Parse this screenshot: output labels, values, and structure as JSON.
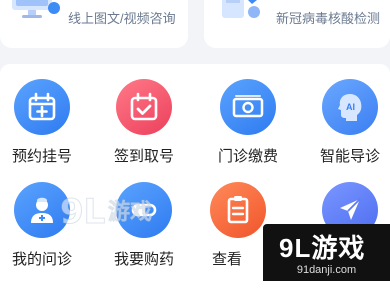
{
  "top_cards": [
    {
      "label": "线上图文/视频咨询",
      "icon": "consult-icon"
    },
    {
      "label": "新冠病毒核酸检测",
      "icon": "covid-test-icon"
    }
  ],
  "grid": {
    "items": [
      {
        "label": "预约挂号",
        "icon": "calendar-plus-icon",
        "color": "#3d8bf5"
      },
      {
        "label": "签到取号",
        "icon": "calendar-check-icon",
        "color": "#f0506a"
      },
      {
        "label": "门诊缴费",
        "icon": "money-icon",
        "color": "#3d8bf5"
      },
      {
        "label": "智能导诊",
        "icon": "ai-head-icon",
        "color": "#4a8ff7"
      },
      {
        "label": "我的问诊",
        "icon": "doctor-icon",
        "color": "#3d8bf5"
      },
      {
        "label": "我要购药",
        "icon": "pill-icon",
        "color": "#3d8bf5"
      },
      {
        "label": "查看",
        "icon": "clipboard-icon",
        "color": "#f46a3c"
      },
      {
        "label": "",
        "icon": "send-icon",
        "color": "#5b7cf5"
      }
    ]
  },
  "watermark": {
    "brand": "9L游戏",
    "url": "91danji.com"
  }
}
